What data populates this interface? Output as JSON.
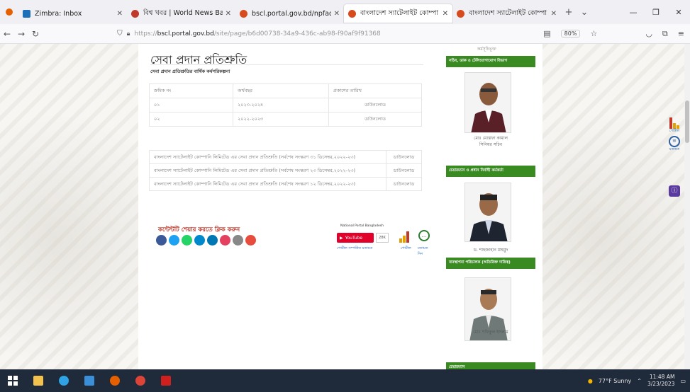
{
  "browser": {
    "tabs": [
      {
        "title": "Zimbra: Inbox",
        "active": false,
        "color": "#1d6fb8"
      },
      {
        "title": "বিশ্ব খবর | World News Bangl",
        "active": false,
        "color": "#c0392b"
      },
      {
        "title": "bscl.portal.gov.bd/npfadmi",
        "active": false,
        "color": "#d64a1e"
      },
      {
        "title": "বাংলাদেশ স্যাটেলাইট কোম্পা",
        "active": true,
        "color": "#d64a1e"
      },
      {
        "title": "বাংলাদেশ স্যাটেলাইট কোম্পা",
        "active": false,
        "color": "#d64a1e"
      }
    ],
    "url_prefix": "https://",
    "url_host": "bscl.portal.gov.bd",
    "url_path": "/site/page/b6d00738-34a9-436c-ab98-f90af9f91368",
    "zoom": "80%"
  },
  "page": {
    "title": "সেবা প্রদান প্রতিশ্রুতি",
    "subtitle": "সেবা প্রদান প্রতিশ্রুতির বার্ষিক কর্মপরিকল্পনা",
    "table1": {
      "headers": [
        "ক্রমিক নং",
        "অর্থবছর",
        "প্রকাশের তারিখ"
      ],
      "rows": [
        [
          "০১",
          "২০২৩-২০২৪",
          "ডাউনলোড"
        ],
        [
          "০২",
          "২০২২-২০২৩",
          "ডাউনলোড"
        ]
      ]
    },
    "table2": {
      "rows": [
        [
          "বাংলাদেশ স্যাটেলাইট কোম্পানি লিমিটেড এর সেবা প্রদান প্রতিশ্রুতি (সর্বশেষ সংস্করণ ৩১ ডিসেম্বর,২০২২-২৩)",
          "ডাউনলোড"
        ],
        [
          "বাংলাদেশ স্যাটেলাইট কোম্পানি লিমিটেড এর সেবা প্রদান প্রতিশ্রুতি (সর্বশেষ সংস্করণ ২৩ ডিসেম্বর,২০২২-২৩)",
          "ডাউনলোড"
        ],
        [
          "বাংলাদেশ স্যাটেলাইট কোম্পানি লিমিটেড এর সেবা প্রদান প্রতিশ্রুতি (সর্বশেষ সংস্করণ ১২ ডিসেম্বর,২০২২-২৩)",
          "ডাউনলোড"
        ]
      ]
    },
    "share_text": "কন্টেন্টটি শেয়ার করতে ক্লিক করুন",
    "social_colors": [
      "#3b5998",
      "#1da1f2",
      "#25d366",
      "#0088cc",
      "#0077b5",
      "#e4405f",
      "#888888",
      "#e74c3c"
    ],
    "widgets": {
      "np_label": "National Portal Bangladesh",
      "youtube": "YouTube",
      "youtube_count": "28K",
      "label_a": "পোর্টাল সম্পর্কিত মতামত",
      "label_b": "পোর্টাল",
      "label_c": "মতামত দিন"
    }
  },
  "sidebar": {
    "top_text": "কর্মসূচিভূক্ত",
    "section1": "সচিব, ডাক ও টেলিযোগাযোগ বিভাগ",
    "person1_name": "মোঃ মোস্তফা কামাল",
    "person1_role": "সিনিয়র সচিব",
    "section2": "চেয়ারম্যান ও প্রধান নির্বাহী কর্মকর্তা",
    "person2_name": "ড. শাহজাহান মাহমুদ",
    "section3": "ব্যবস্থাপনা পরিচালক (অতিরিক্ত দায়িত্ব)",
    "person3_name": "মোঃ শফিকুল ইসলাম",
    "section4": "চেয়ারম্যান"
  },
  "floating": {
    "label1": "পোর্টাল",
    "label2": "মতামত"
  },
  "taskbar": {
    "weather": "77°F Sunny",
    "time": "11:48 AM",
    "date": "3/23/2023"
  }
}
